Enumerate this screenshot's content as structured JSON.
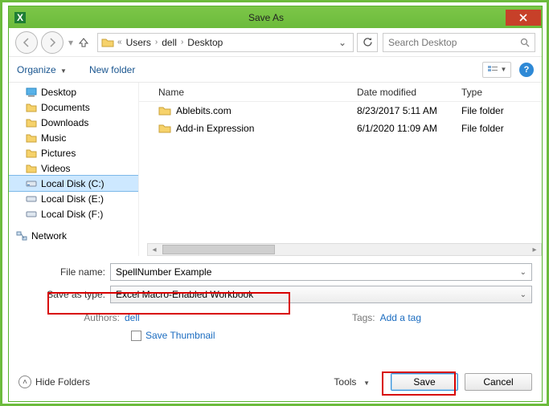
{
  "window": {
    "title": "Save As"
  },
  "nav": {
    "path_parts": [
      "Users",
      "dell",
      "Desktop"
    ],
    "search_placeholder": "Search Desktop"
  },
  "toolbar": {
    "organize": "Organize",
    "new_folder": "New folder"
  },
  "tree": {
    "items": [
      {
        "label": "Desktop",
        "kind": "desktop"
      },
      {
        "label": "Documents",
        "kind": "folder"
      },
      {
        "label": "Downloads",
        "kind": "folder"
      },
      {
        "label": "Music",
        "kind": "folder"
      },
      {
        "label": "Pictures",
        "kind": "folder"
      },
      {
        "label": "Videos",
        "kind": "folder"
      },
      {
        "label": "Local Disk (C:)",
        "kind": "drive",
        "selected": true
      },
      {
        "label": "Local Disk (E:)",
        "kind": "drive"
      },
      {
        "label": "Local Disk (F:)",
        "kind": "drive"
      },
      {
        "label": "Network",
        "kind": "network"
      }
    ]
  },
  "list": {
    "headers": {
      "name": "Name",
      "date": "Date modified",
      "type": "Type"
    },
    "rows": [
      {
        "name": "Ablebits.com",
        "date": "8/23/2017 5:11 AM",
        "type": "File folder"
      },
      {
        "name": "Add-in Expression",
        "date": "6/1/2020 11:09 AM",
        "type": "File folder"
      }
    ]
  },
  "form": {
    "filename_label": "File name:",
    "filename_value": "SpellNumber Example",
    "savetype_label": "Save as type:",
    "savetype_value": "Excel Macro-Enabled Workbook",
    "authors_label": "Authors:",
    "authors_value": "dell",
    "tags_label": "Tags:",
    "tags_value": "Add a tag",
    "save_thumbnail": "Save Thumbnail"
  },
  "footer": {
    "hide_folders": "Hide Folders",
    "tools": "Tools",
    "save": "Save",
    "cancel": "Cancel"
  }
}
